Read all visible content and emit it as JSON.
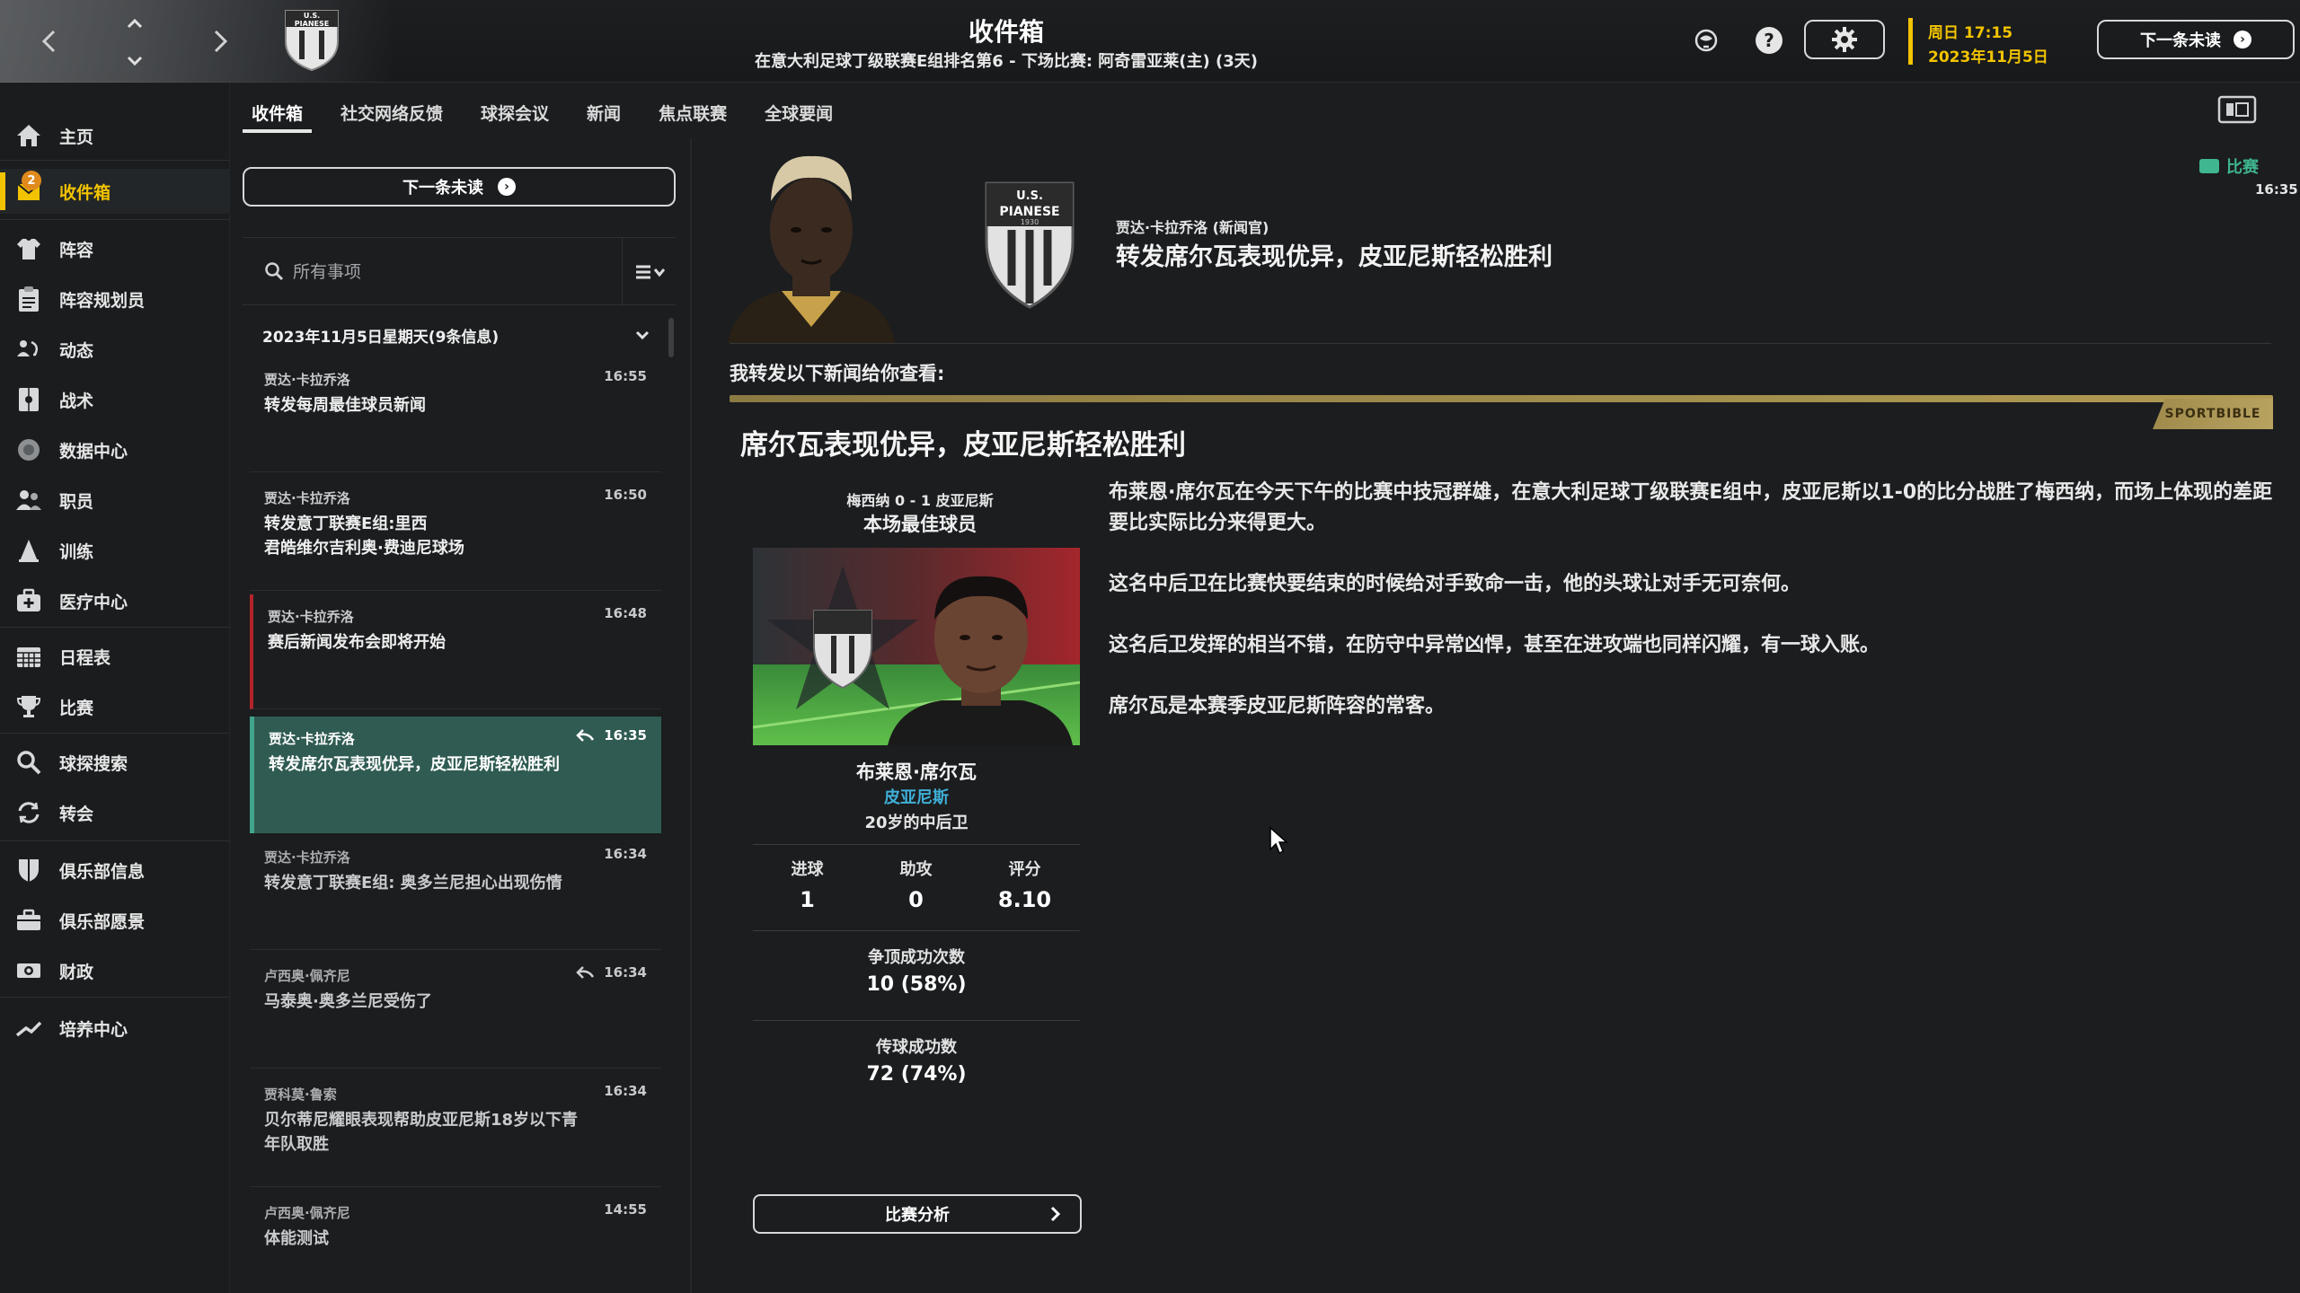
{
  "header": {
    "title": "收件箱",
    "subtitle": "在意大利足球丁级联赛E组排名第6 - 下场比赛: 阿奇雷亚莱(主) (3天)",
    "date_day": "周日 17:15",
    "date_full": "2023年11月5日",
    "next_unread_label": "下一条未读",
    "accent_color": "#f2c300"
  },
  "sidebar": {
    "inbox_badge": "2",
    "items": [
      {
        "label": "主页",
        "icon": "home-icon"
      },
      {
        "label": "收件箱",
        "icon": "inbox-icon"
      },
      {
        "label": "阵容",
        "icon": "squad-icon"
      },
      {
        "label": "阵容规划员",
        "icon": "clipboard-icon"
      },
      {
        "label": "动态",
        "icon": "dynamics-icon"
      },
      {
        "label": "战术",
        "icon": "tactics-icon"
      },
      {
        "label": "数据中心",
        "icon": "data-hub-icon"
      },
      {
        "label": "职员",
        "icon": "staff-icon"
      },
      {
        "label": "训练",
        "icon": "training-icon"
      },
      {
        "label": "医疗中心",
        "icon": "medical-icon"
      },
      {
        "label": "日程表",
        "icon": "calendar-icon"
      },
      {
        "label": "比赛",
        "icon": "trophy-icon"
      },
      {
        "label": "球探搜索",
        "icon": "scout-search-icon"
      },
      {
        "label": "转会",
        "icon": "transfer-icon"
      },
      {
        "label": "俱乐部信息",
        "icon": "shield-icon"
      },
      {
        "label": "俱乐部愿景",
        "icon": "vision-icon"
      },
      {
        "label": "财政",
        "icon": "finance-icon"
      },
      {
        "label": "培养中心",
        "icon": "development-icon"
      }
    ]
  },
  "tabs": [
    {
      "label": "收件箱"
    },
    {
      "label": "社交网络反馈"
    },
    {
      "label": "球探会议"
    },
    {
      "label": "新闻"
    },
    {
      "label": "焦点联赛"
    },
    {
      "label": "全球要闻"
    }
  ],
  "list": {
    "next_unread_label": "下一条未读",
    "search_placeholder": "所有事项",
    "date_group": "2023年11月5日星期天(9条信息)",
    "messages": [
      {
        "sender": "贾达·卡拉乔洛",
        "time": "16:55",
        "subject": "转发每周最佳球员新闻"
      },
      {
        "sender": "贾达·卡拉乔洛",
        "time": "16:50",
        "subject": "转发意丁联赛E组:里西\n君皓维尔吉利奥·费迪尼球场"
      },
      {
        "sender": "贾达·卡拉乔洛",
        "time": "16:48",
        "subject": "赛后新闻发布会即将开始"
      },
      {
        "sender": "贾达·卡拉乔洛",
        "time": "16:35",
        "subject": "转发席尔瓦表现优异，皮亚尼斯轻松胜利"
      },
      {
        "sender": "贾达·卡拉乔洛",
        "time": "16:34",
        "subject": "转发意丁联赛E组: 奥多兰尼担心出现伤情"
      },
      {
        "sender": "卢西奥·佩齐尼",
        "time": "16:34",
        "subject": "马泰奥·奥多兰尼受伤了"
      },
      {
        "sender": "贾科莫·鲁索",
        "time": "16:34",
        "subject": "贝尔蒂尼耀眼表现帮助皮亚尼斯18岁以下青\n年队取胜"
      },
      {
        "sender": "卢西奥·佩齐尼",
        "time": "14:55",
        "subject": "体能测试"
      }
    ]
  },
  "detail": {
    "sender_line": "贾达·卡拉乔洛 (新闻官)",
    "title": "转发席尔瓦表现优异，皮亚尼斯轻松胜利",
    "badge_label": "比赛",
    "badge_time": "16:35",
    "forward_intro": "我转发以下新闻给你查看:",
    "source": "SPORTBIBLE",
    "headline": "席尔瓦表现优异，皮亚尼斯轻松胜利",
    "paragraphs": [
      "布莱恩·席尔瓦在今天下午的比赛中技冠群雄，在意大利足球丁级联赛E组中，皮亚尼斯以1-0的比分战胜了梅西纳，而场上体现的差距要比实际比分来得更大。",
      "这名中后卫在比赛快要结束的时候给对手致命一击，他的头球让对手无可奈何。",
      "这名后卫发挥的相当不错，在防守中异常凶悍，甚至在进攻端也同样闪耀，有一球入账。",
      "席尔瓦是本赛季皮亚尼斯阵容的常客。"
    ],
    "card": {
      "score": "梅西纳 0 - 1 皮亚尼斯",
      "award": "本场最佳球员",
      "name": "布莱恩·席尔瓦",
      "club": "皮亚尼斯",
      "desc": "20岁的中后卫",
      "stats": [
        {
          "label": "进球",
          "value": "1"
        },
        {
          "label": "助攻",
          "value": "0"
        },
        {
          "label": "评分",
          "value": "8.10"
        }
      ],
      "headers_label": "争顶成功次数",
      "headers_value": "10 (58%)",
      "passes_label": "传球成功数",
      "passes_value": "72 (74%)",
      "analysis_label": "比赛分析"
    },
    "club_crest_text": [
      "U.S.",
      "PIANESE",
      "1930"
    ]
  },
  "colors": {
    "selected_row": "#2f5b52",
    "selected_accent": "#41a58c",
    "match_badge": "#3fb690",
    "club_link": "#3fb0d8",
    "urgent": "#b3242a"
  }
}
